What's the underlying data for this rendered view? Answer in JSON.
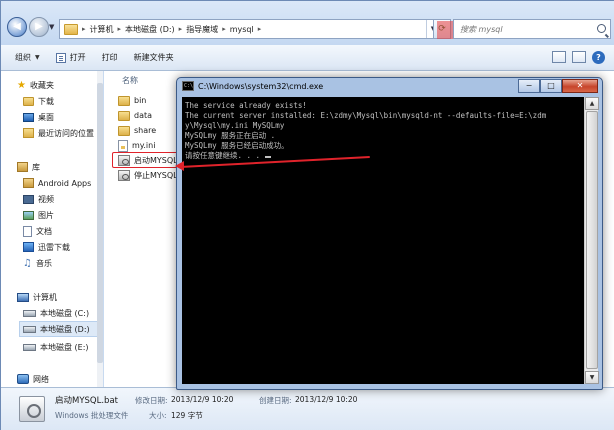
{
  "explorer": {
    "breadcrumb": [
      "计算机",
      "本地磁盘 (D:)",
      "指导魔域",
      "mysql"
    ],
    "search_placeholder": "搜索 mysql",
    "toolbar": {
      "organize": "组织",
      "open": "打开",
      "print": "打印",
      "new_folder": "新建文件夹"
    },
    "nav": {
      "favorites": "收藏夹",
      "downloads": "下载",
      "desktop": "桌面",
      "recent": "最近访问的位置",
      "library": "库",
      "android_apps": "Android Apps",
      "video": "视频",
      "pictures": "图片",
      "documents": "文档",
      "xunlei": "迅雷下载",
      "music": "音乐",
      "computer": "计算机",
      "drive_c": "本地磁盘 (C:)",
      "drive_d": "本地磁盘 (D:)",
      "drive_e": "本地磁盘 (E:)",
      "network": "网络"
    },
    "column_name": "名称",
    "files": [
      "bin",
      "data",
      "share",
      "my.ini",
      "启动MYSQL",
      "停止MYSQL"
    ],
    "details": {
      "filename": "启动MYSQL.bat",
      "filetype": "Windows 批处理文件",
      "modified_label": "修改日期:",
      "modified_value": "2013/12/9 10:20",
      "created_label": "创建日期:",
      "created_value": "2013/12/9 10:20",
      "size_label": "大小:",
      "size_value": "129 字节"
    }
  },
  "cmd": {
    "title": "C:\\Windows\\system32\\cmd.exe",
    "icon_text": "C:\\",
    "buttons": {
      "minimize": "−",
      "maximize": "□",
      "close": "✕"
    },
    "lines": [
      "The service already exists!",
      "The current server installed: E:\\zdmy\\Mysql\\bin\\mysqld-nt --defaults-file=E:\\zdm",
      "y\\Mysql\\my.ini MySQLmy",
      "MySQLmy 服务正在启动 .",
      "MySQLmy 服务已经启动成功。",
      "",
      "请按任意键继续. . . "
    ]
  },
  "colors": {
    "annotation_red": "#e0232b",
    "console_bg": "#000000",
    "console_text": "#c0c0c0"
  }
}
